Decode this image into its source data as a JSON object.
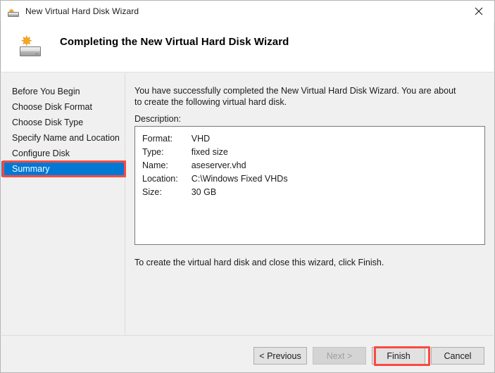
{
  "window": {
    "title": "New Virtual Hard Disk Wizard",
    "title_icon": "hard-disk-new-icon",
    "close_icon": "close-icon"
  },
  "header": {
    "icon": "hard-disk-new-icon",
    "title": "Completing the New Virtual Hard Disk Wizard"
  },
  "sidebar": {
    "items": [
      {
        "label": "Before You Begin",
        "selected": false
      },
      {
        "label": "Choose Disk Format",
        "selected": false
      },
      {
        "label": "Choose Disk Type",
        "selected": false
      },
      {
        "label": "Specify Name and Location",
        "selected": false
      },
      {
        "label": "Configure Disk",
        "selected": false
      },
      {
        "label": "Summary",
        "selected": true
      }
    ]
  },
  "main": {
    "intro": "You have successfully completed the New Virtual Hard Disk Wizard. You are about to create the following virtual hard disk.",
    "description_label": "Description:",
    "description_rows": [
      {
        "key": "Format:",
        "value": "VHD"
      },
      {
        "key": "Type:",
        "value": "fixed size"
      },
      {
        "key": "Name:",
        "value": "aseserver.vhd"
      },
      {
        "key": "Location:",
        "value": "C:\\Windows Fixed VHDs"
      },
      {
        "key": "Size:",
        "value": "30 GB"
      }
    ],
    "outro": "To create the virtual hard disk and close this wizard, click Finish."
  },
  "footer": {
    "buttons": [
      {
        "label": "< Previous",
        "disabled": false
      },
      {
        "label": "Next >",
        "disabled": true
      },
      {
        "label": "Finish",
        "disabled": false
      },
      {
        "label": "Cancel",
        "disabled": false
      }
    ]
  },
  "annotations": {
    "color": "#fb4a40",
    "targets": [
      "sidebar-item-summary",
      "finish-button"
    ]
  },
  "colors": {
    "selection_blue": "#0078d4",
    "window_background": "#f0f0f0",
    "panel_white": "#ffffff",
    "annotation_red": "#fb4a40"
  }
}
